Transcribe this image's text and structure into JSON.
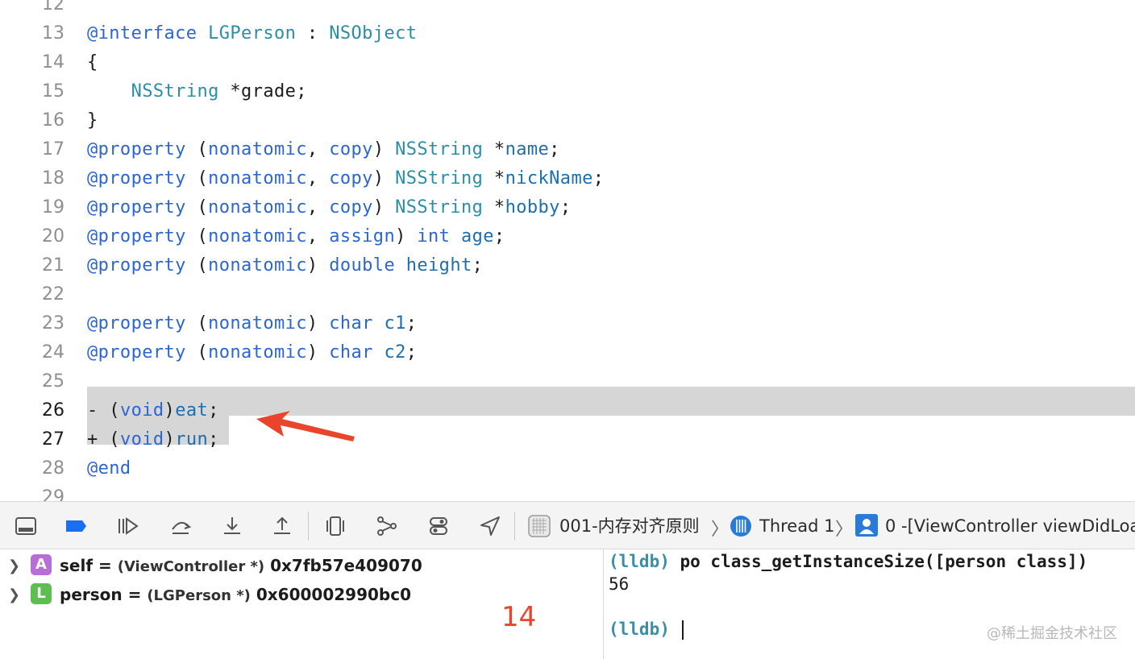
{
  "editor": {
    "lines": [
      {
        "n": "12",
        "tokens": []
      },
      {
        "n": "13",
        "tokens": [
          {
            "t": "@interface",
            "c": "kw"
          },
          {
            "t": " "
          },
          {
            "t": "LGPerson",
            "c": "ty"
          },
          {
            "t": " : "
          },
          {
            "t": "NSObject",
            "c": "ty"
          }
        ]
      },
      {
        "n": "14",
        "tokens": [
          {
            "t": "{"
          }
        ]
      },
      {
        "n": "15",
        "tokens": [
          {
            "t": "    "
          },
          {
            "t": "NSString",
            "c": "ty"
          },
          {
            "t": " *grade;"
          }
        ]
      },
      {
        "n": "16",
        "tokens": [
          {
            "t": "}"
          }
        ]
      },
      {
        "n": "17",
        "tokens": [
          {
            "t": "@property",
            "c": "kw"
          },
          {
            "t": " ("
          },
          {
            "t": "nonatomic",
            "c": "kw"
          },
          {
            "t": ", "
          },
          {
            "t": "copy",
            "c": "kw"
          },
          {
            "t": ") "
          },
          {
            "t": "NSString",
            "c": "ty"
          },
          {
            "t": " *"
          },
          {
            "t": "name",
            "c": "id"
          },
          {
            "t": ";"
          }
        ]
      },
      {
        "n": "18",
        "tokens": [
          {
            "t": "@property",
            "c": "kw"
          },
          {
            "t": " ("
          },
          {
            "t": "nonatomic",
            "c": "kw"
          },
          {
            "t": ", "
          },
          {
            "t": "copy",
            "c": "kw"
          },
          {
            "t": ") "
          },
          {
            "t": "NSString",
            "c": "ty"
          },
          {
            "t": " *"
          },
          {
            "t": "nickName",
            "c": "id"
          },
          {
            "t": ";"
          }
        ]
      },
      {
        "n": "19",
        "tokens": [
          {
            "t": "@property",
            "c": "kw"
          },
          {
            "t": " ("
          },
          {
            "t": "nonatomic",
            "c": "kw"
          },
          {
            "t": ", "
          },
          {
            "t": "copy",
            "c": "kw"
          },
          {
            "t": ") "
          },
          {
            "t": "NSString",
            "c": "ty"
          },
          {
            "t": " *"
          },
          {
            "t": "hobby",
            "c": "id"
          },
          {
            "t": ";"
          }
        ]
      },
      {
        "n": "20",
        "tokens": [
          {
            "t": "@property",
            "c": "kw"
          },
          {
            "t": " ("
          },
          {
            "t": "nonatomic",
            "c": "kw"
          },
          {
            "t": ", "
          },
          {
            "t": "assign",
            "c": "kw"
          },
          {
            "t": ") "
          },
          {
            "t": "int",
            "c": "kw"
          },
          {
            "t": " "
          },
          {
            "t": "age",
            "c": "id"
          },
          {
            "t": ";"
          }
        ]
      },
      {
        "n": "21",
        "tokens": [
          {
            "t": "@property",
            "c": "kw"
          },
          {
            "t": " ("
          },
          {
            "t": "nonatomic",
            "c": "kw"
          },
          {
            "t": ") "
          },
          {
            "t": "double",
            "c": "kw"
          },
          {
            "t": " "
          },
          {
            "t": "height",
            "c": "id"
          },
          {
            "t": ";"
          }
        ]
      },
      {
        "n": "22",
        "tokens": []
      },
      {
        "n": "23",
        "tokens": [
          {
            "t": "@property",
            "c": "kw"
          },
          {
            "t": " ("
          },
          {
            "t": "nonatomic",
            "c": "kw"
          },
          {
            "t": ") "
          },
          {
            "t": "char",
            "c": "kw"
          },
          {
            "t": " "
          },
          {
            "t": "c1",
            "c": "id"
          },
          {
            "t": ";"
          }
        ]
      },
      {
        "n": "24",
        "tokens": [
          {
            "t": "@property",
            "c": "kw"
          },
          {
            "t": " ("
          },
          {
            "t": "nonatomic",
            "c": "kw"
          },
          {
            "t": ") "
          },
          {
            "t": "char",
            "c": "kw"
          },
          {
            "t": " "
          },
          {
            "t": "c2",
            "c": "id"
          },
          {
            "t": ";"
          }
        ]
      },
      {
        "n": "25",
        "tokens": []
      },
      {
        "n": "26",
        "cur": true,
        "tokens": [
          {
            "t": "- ("
          },
          {
            "t": "void",
            "c": "kw"
          },
          {
            "t": ")"
          },
          {
            "t": "eat",
            "c": "id"
          },
          {
            "t": ";"
          }
        ]
      },
      {
        "n": "27",
        "cur": true,
        "tokens": [
          {
            "t": "+ ("
          },
          {
            "t": "void",
            "c": "kw"
          },
          {
            "t": ")"
          },
          {
            "t": "run",
            "c": "id"
          },
          {
            "t": ";"
          }
        ]
      },
      {
        "n": "28",
        "tokens": [
          {
            "t": "@end",
            "c": "kw"
          }
        ]
      },
      {
        "n": "29",
        "tokens": []
      }
    ]
  },
  "toolbar": {
    "icons": [
      "hide-debug-area-icon",
      "breakpoints-toggle-icon",
      "continue-icon",
      "step-over-icon",
      "step-into-icon",
      "step-out-icon",
      "view-hierarchy-icon",
      "memory-graph-icon",
      "environment-overrides-icon",
      "simulate-location-icon"
    ],
    "crumb_project": "001-内存对齐原则",
    "crumb_thread": "Thread 1",
    "crumb_frame": "0 -[ViewController viewDidLoa"
  },
  "variables": [
    {
      "badge": "A",
      "badge_color": "#b76ed6",
      "name": "self",
      "eq": " = ",
      "type": "(ViewController *)",
      "value": " 0x7fb57e409070"
    },
    {
      "badge": "L",
      "badge_color": "#5cbf50",
      "name": "person",
      "eq": " = ",
      "type": "(LGPerson *)",
      "value": " 0x600002990bc0"
    }
  ],
  "annotation": {
    "count": "14",
    "color": "#e8452c"
  },
  "console": {
    "prompt": "(lldb)",
    "command": " po class_getInstanceSize([person class])",
    "result": "56",
    "prompt2": "(lldb)"
  },
  "watermark": "@稀土掘金技术社区",
  "colors": {
    "keyword": "#2d66d2",
    "type": "#2a8fa6",
    "identifier": "#1d6fb0",
    "highlight": "#d6d6d6",
    "arrow": "#e8452c"
  }
}
